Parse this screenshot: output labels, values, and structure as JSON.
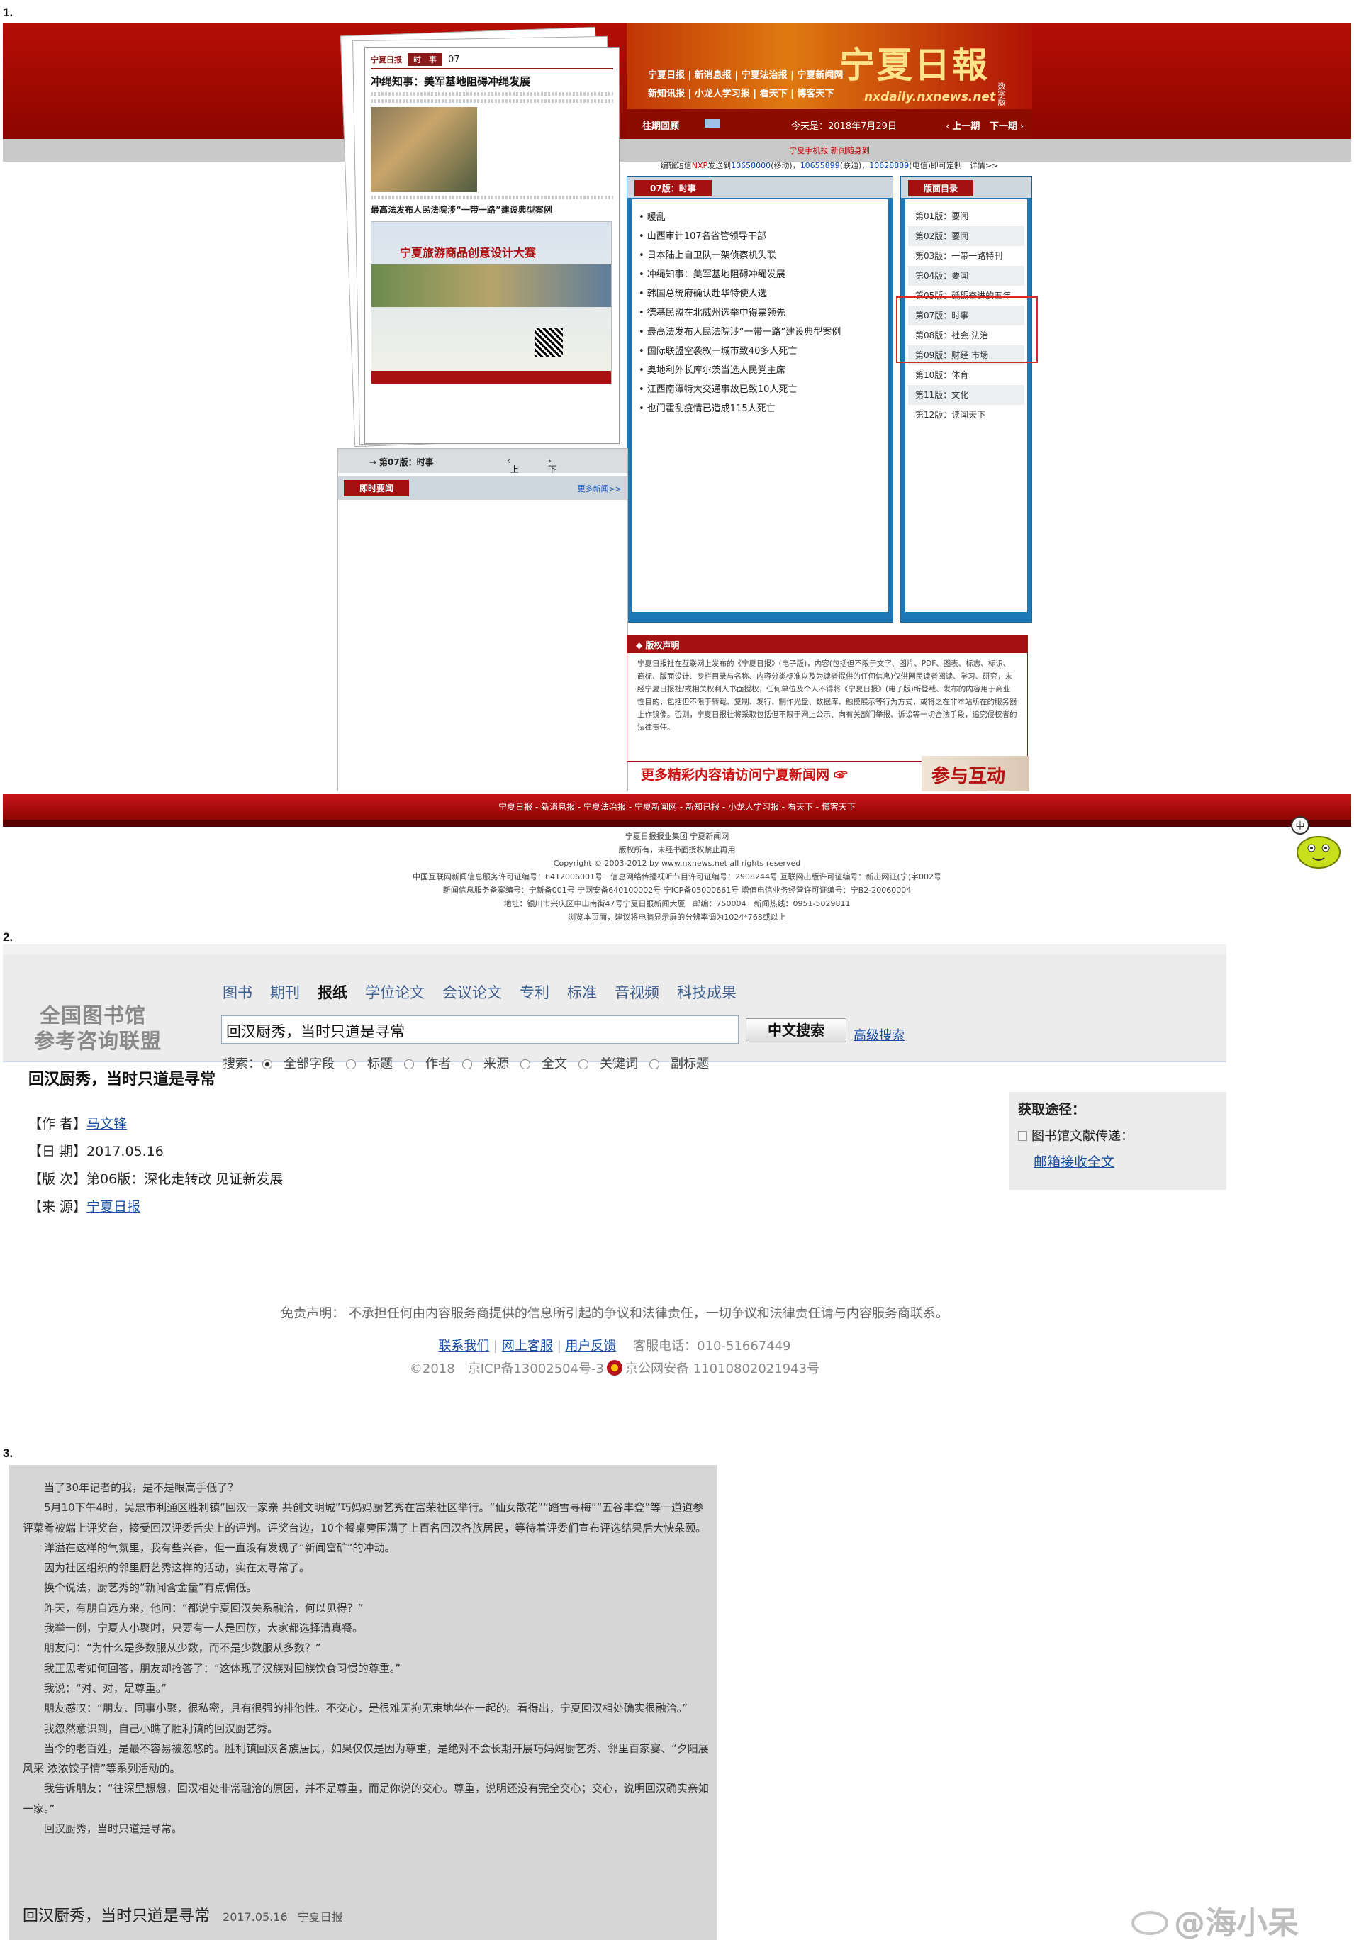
{
  "markers": {
    "m1": "1.",
    "m2": "2.",
    "m3": "3."
  },
  "s1": {
    "paper": {
      "logo": "宁夏日报",
      "section": "时　事",
      "page": "07",
      "headline": "冲绳知事：美军基地阻碍冲绳发展",
      "subheadline": "最高法发布人民法院涉“一带一路”建设典型案例",
      "ad_text": "宁夏旅游商品创意设计大赛"
    },
    "banner": {
      "links_row1": "宁夏日报 | 新消息报 | 宁夏法治报 | 宁夏新闻网",
      "links_row2": "新知讯报 | 小龙人学习报 | 看天下 | 博客天下",
      "brand": "宁夏日報",
      "domain": "nxdaily.nxnews.net",
      "edition": "数字版"
    },
    "datebar": {
      "history": "往期回顾",
      "today": "今天是：2018年7月29日",
      "prev": "上一期",
      "next": "下一期"
    },
    "mobile": "宁夏手机报  新闻随身到",
    "sms": {
      "prefix": "编辑短信",
      "nxp": "NXP",
      "send": "发送到",
      "n1": "10658000",
      "t1": "(移动)，",
      "n2": "10655899",
      "t2": "(联通)，",
      "n3": "10628889",
      "t3": "(电信)即可定制",
      "detail": "详情>>"
    },
    "news_tab": "07版：时事",
    "news": [
      "暖乱",
      "山西审计107名省管领导干部",
      "日本陆上自卫队一架侦察机失联",
      "冲绳知事：美军基地阻碍冲绳发展",
      "韩国总统府确认赴华特使人选",
      "德基民盟在北威州选举中得票领先",
      "最高法发布人民法院涉“一带一路”建设典型案例",
      "国际联盟空袭叙一城市致40多人死亡",
      "奥地利外长库尔茨当选人民党主席",
      "江西南潭特大交通事故已致10人死亡",
      "也门霍乱疫情已造成115人死亡"
    ],
    "version_tab": "版面目录",
    "versions": [
      "第01版：要闻",
      "第02版：要闻",
      "第03版：一带一路特刊",
      "第04版：要闻",
      "第05版：砥砺奋进的五年",
      "第07版：时事",
      "第08版：社会·法治",
      "第09版：财经·市场",
      "第10版：体育",
      "第11版：文化",
      "第12版：读闻天下"
    ],
    "leftnav": {
      "current": "第07版：时事",
      "prev": "上一版",
      "next": "下一版"
    },
    "instant": {
      "tab": "即时要闻",
      "more": "更多新闻>>"
    },
    "copyright": {
      "title": "版权声明",
      "body": "宁夏日报社在互联网上发布的《宁夏日报》(电子版)，内容(包括但不限于文字、图片、PDF、图表、标志、标识、商标、版面设计、专栏目录与名称、内容分类标准以及为读者提供的任何信息)仅供网民读者阅读、学习、研究，未经宁夏日报社/或相关权利人书面授权，任何单位及个人不得将《宁夏日报》(电子版)所登载、发布的内容用于商业性目的，包括但不限于转载、复制、发行、制作光盘、数据库、触摸展示等行为方式，或将之在非本站所在的服务器上作镜像。否则，宁夏日报社将采取包括但不限于网上公示、向有关部门举报、诉讼等一切合法手段，追究侵权者的法律责任。"
    },
    "more": "更多精彩内容请访问宁夏新闻网",
    "interact": "参与互动",
    "footer_links": "宁夏日报 - 新消息报 - 宁夏法治报 - 宁夏新闻网 - 新知讯报 - 小龙人学习报 - 看天下 - 博客天下",
    "footer_lines": [
      "宁夏日报报业集团 宁夏新闻网",
      "版权所有，未经书面授权禁止再用",
      "Copyright © 2003-2012 by www.nxnews.net all rights reserved",
      "中国互联网新闻信息服务许可证编号：6412006001号　信息网络传播视听节目许可证编号：2908244号 互联网出版许可证编号：新出网证(宁)字002号",
      "新闻信息服务备案编号：宁新备001号 宁网安备640100002号 宁ICP备05000661号 增值电信业务经营许可证编号：宁B2-20060004",
      "地址：银川市兴庆区中山南街47号宁夏日报新闻大厦　邮编：750004　新闻热线：0951-5029811",
      "浏览本页面，建议将电脑显示屏的分辨率调为1024*768或以上"
    ],
    "mascot_text": "中"
  },
  "s2": {
    "logo_l1": "全国图书馆",
    "logo_l2": "参考咨询联盟",
    "categories": [
      "图书",
      "期刊",
      "报纸",
      "学位论文",
      "会议论文",
      "专利",
      "标准",
      "音视频",
      "科技成果"
    ],
    "active_category": "报纸",
    "search_value": "回汉厨秀，当时只道是寻常",
    "search_button": "中文搜索",
    "advanced": "高级搜索",
    "search_label": "搜索：",
    "options": [
      "全部字段",
      "标题",
      "作者",
      "来源",
      "全文",
      "关键词",
      "副标题"
    ],
    "title": "回汉厨秀，当时只道是寻常",
    "author_label": "【作 者】",
    "author": "马文锋",
    "date_label": "【日 期】",
    "date": "2017.05.16",
    "page_label": "【版 次】",
    "page": "第06版：深化走转改 见证新发展",
    "source_label": "【来 源】",
    "source": "宁夏日报",
    "get_title": "获取途径：",
    "get_service": "图书馆文献传递：",
    "get_link": "邮箱接收全文",
    "disclaimer": "免责声明：  不承担任何由内容服务商提供的信息所引起的争议和法律责任，一切争议和法律责任请与内容服务商联系。",
    "contact": "联系我们",
    "service": "网上客服",
    "feedback": "用户反馈",
    "phone": "客服电话：010-51667449",
    "year": "©2018",
    "icp": "京ICP备13002504号-3",
    "police": "京公网安备 11010802021943号"
  },
  "s3": {
    "paragraphs": [
      "当了30年记者的我，是不是眼高手低了？",
      "5月10下午4时，吴忠市利通区胜利镇“回汉一家亲 共创文明城”巧妈妈厨艺秀在富荣社区举行。“仙女散花”“踏雪寻梅”“五谷丰登”等一道道参评菜肴被端上评奖台，接受回汉评委舌尖上的评判。评奖台边，10个餐桌旁围满了上百名回汉各族居民，等待着评委们宣布评选结果后大快朵颐。",
      "洋溢在这样的气氛里，我有些兴奋，但一直没有发现了“新闻富矿”的冲动。",
      "因为社区组织的邻里厨艺秀这样的活动，实在太寻常了。",
      "换个说法，厨艺秀的“新闻含金量”有点偏低。",
      "昨天，有朋自远方来，他问：“都说宁夏回汉关系融洽，何以见得？”",
      "我举一例，宁夏人小聚时，只要有一人是回族，大家都选择清真餐。",
      "朋友问：“为什么是多数服从少数，而不是少数服从多数？”",
      "我正思考如何回答，朋友却抢答了：“这体现了汉族对回族饮食习惯的尊重。”",
      "我说：“对、对，是尊重。”",
      "朋友感叹：“朋友、同事小聚，很私密，具有很强的排他性。不交心，是很难无拘无束地坐在一起的。看得出，宁夏回汉相处确实很融洽。”",
      "我忽然意识到，自己小瞧了胜利镇的回汉厨艺秀。",
      "当今的老百姓，是最不容易被忽悠的。胜利镇回汉各族居民，如果仅仅是因为尊重，是绝对不会长期开展巧妈妈厨艺秀、邻里百家宴、“夕阳展风采 浓浓饺子情”等系列活动的。",
      "我告诉朋友：“往深里想想，回汉相处非常融洽的原因，并不是尊重，而是你说的交心。尊重，说明还没有完全交心；交心，说明回汉确实亲如一家。”",
      "回汉厨秀，当时只道是寻常。"
    ],
    "foot_title": "回汉厨秀，当时只道是寻常",
    "foot_date": "2017.05.16",
    "foot_paper": "宁夏日报"
  },
  "watermark": "@海小呆"
}
